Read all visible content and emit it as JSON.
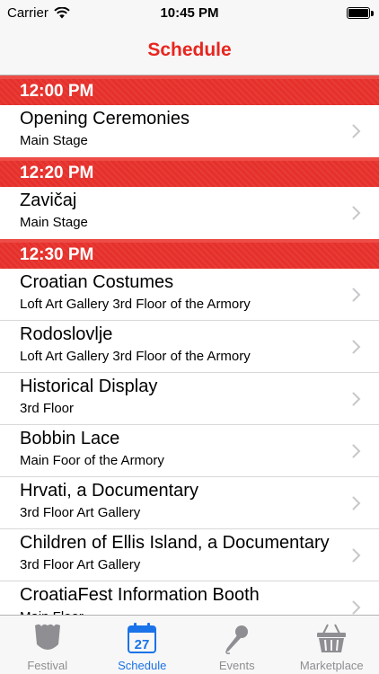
{
  "status_bar": {
    "carrier": "Carrier",
    "time": "10:45 PM"
  },
  "nav": {
    "title": "Schedule"
  },
  "colors": {
    "accent_red": "#e8261f",
    "section_red": "#e6302b",
    "tab_active": "#1a73e8",
    "tab_inactive": "#8e8e93"
  },
  "sections": [
    {
      "time": "12:00 PM",
      "rows": [
        {
          "title": "Opening Ceremonies",
          "subtitle": "Main Stage"
        }
      ]
    },
    {
      "time": "12:20 PM",
      "rows": [
        {
          "title": "Zavičaj",
          "subtitle": "Main Stage"
        }
      ]
    },
    {
      "time": "12:30 PM",
      "rows": [
        {
          "title": "Croatian Costumes",
          "subtitle": "Loft Art Gallery 3rd Floor of the Armory"
        },
        {
          "title": "Rodoslovlje",
          "subtitle": "Loft Art Gallery 3rd Floor of the Armory"
        },
        {
          "title": "Historical Display",
          "subtitle": "3rd Floor"
        },
        {
          "title": "Bobbin Lace",
          "subtitle": "Main Foor of the Armory"
        },
        {
          "title": "Hrvati, a Documentary",
          "subtitle": "3rd Floor Art Gallery"
        },
        {
          "title": "Children of Ellis Island, a Documentary",
          "subtitle": "3rd Floor Art Gallery"
        },
        {
          "title": "CroatiaFest Information Booth",
          "subtitle": "Main Floor"
        }
      ]
    }
  ],
  "tabs": [
    {
      "label": "Festival",
      "icon": "shield-icon",
      "active": false
    },
    {
      "label": "Schedule",
      "icon": "calendar-icon",
      "calendar_day": "27",
      "active": true
    },
    {
      "label": "Events",
      "icon": "microphone-icon",
      "active": false
    },
    {
      "label": "Marketplace",
      "icon": "basket-icon",
      "active": false
    }
  ]
}
